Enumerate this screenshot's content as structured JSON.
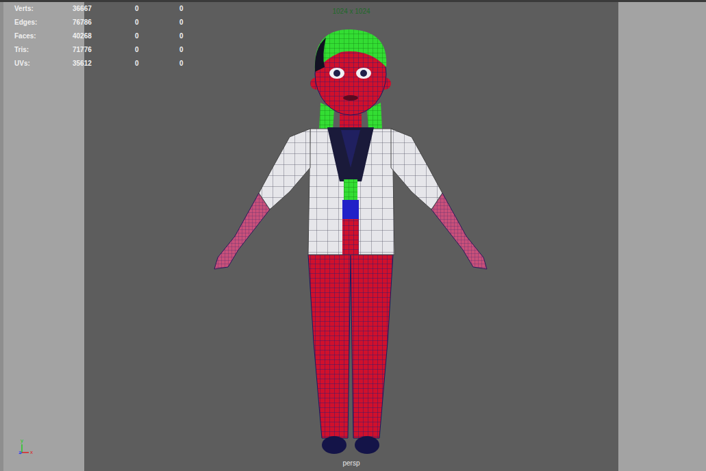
{
  "hud": {
    "rows": [
      {
        "label": "Verts:",
        "values": [
          "36667",
          "0",
          "0"
        ]
      },
      {
        "label": "Edges:",
        "values": [
          "76786",
          "0",
          "0"
        ]
      },
      {
        "label": "Faces:",
        "values": [
          "40268",
          "0",
          "0"
        ]
      },
      {
        "label": "Tris:",
        "values": [
          "71776",
          "0",
          "0"
        ]
      },
      {
        "label": "UVs:",
        "values": [
          "35612",
          "0",
          "0"
        ]
      }
    ]
  },
  "resolution_gate": "1024 x 1024",
  "camera": "persp",
  "axis": {
    "y": "y",
    "z": "z",
    "x": "x"
  }
}
